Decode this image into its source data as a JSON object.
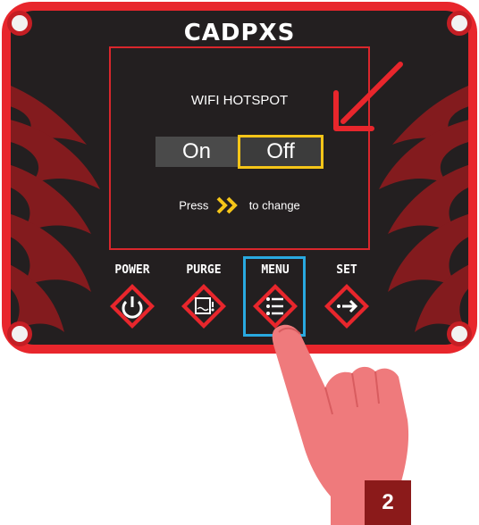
{
  "brand": "CADPXS",
  "screen": {
    "title": "WIFI HOTSPOT",
    "options": {
      "on": "On",
      "off": "Off"
    },
    "selected": "Off",
    "hint_prefix": "Press",
    "hint_suffix": "to change"
  },
  "buttons": [
    {
      "label": "POWER",
      "icon": "power-icon"
    },
    {
      "label": "PURGE",
      "icon": "purge-icon"
    },
    {
      "label": "MENU",
      "icon": "menu-list-icon"
    },
    {
      "label": "SET",
      "icon": "enter-arrow-icon"
    }
  ],
  "highlighted_button": "MENU",
  "step_number": "2",
  "colors": {
    "panel_red": "#e8262c",
    "panel_black": "#231f20",
    "selection_yellow": "#f5c518",
    "highlight_blue": "#29a9e0",
    "arrow_red": "#e8262c",
    "badge": "#8b1a1a"
  }
}
